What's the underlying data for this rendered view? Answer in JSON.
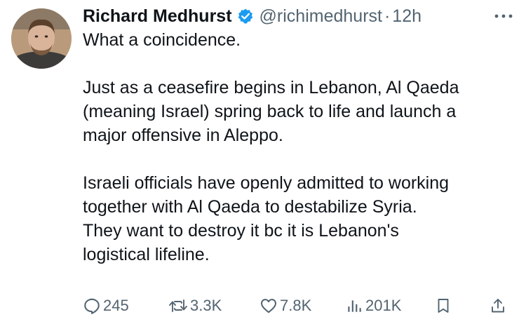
{
  "author": {
    "name": "Richard Medhurst",
    "handle": "@richimedhurst",
    "separator": "·",
    "time": "12h",
    "avatar_icon": "avatar-photo",
    "verified_icon": "verified-badge-icon"
  },
  "tweet": {
    "paragraphs": [
      "What a coincidence.",
      "Just as a ceasefire begins in Lebanon, Al Qaeda\n(meaning Israel) spring back to life and launch a\nmajor offensive in Aleppo.",
      "Israeli officials have openly admitted to working\ntogether with Al Qaeda to destabilize Syria.\nThey want to destroy it bc it is Lebanon's\nlogistical lifeline."
    ]
  },
  "actions": {
    "replies": "245",
    "retweets": "3.3K",
    "likes": "7.8K",
    "views": "201K"
  },
  "colors": {
    "text": "#0f1419",
    "secondary": "#536471",
    "verified": "#1d9bf0",
    "background": "#ffffff"
  }
}
